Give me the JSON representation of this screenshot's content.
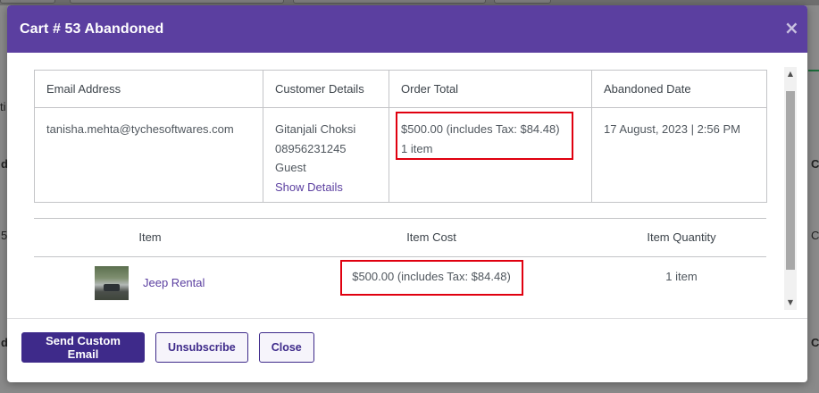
{
  "background": {
    "edge_letters": [
      "d",
      "C",
      "5",
      "C",
      "d",
      "C",
      "ti"
    ]
  },
  "modal": {
    "title": "Cart # 53  Abandoned",
    "close_label": "×"
  },
  "details_table": {
    "headers": [
      "Email Address",
      "Customer Details",
      "Order Total",
      "Abandoned Date"
    ],
    "email": "tanisha.mehta@tychesoftwares.com",
    "customer_name": "Gitanjali Choksi",
    "customer_phone": "08956231245",
    "customer_type": "Guest",
    "show_details_link": "Show Details",
    "order_total": "$500.00 (includes Tax: $84.48)",
    "order_items": "1 item",
    "abandoned_date": "17 August, 2023 | 2:56 PM"
  },
  "items_table": {
    "headers": [
      "Item",
      "Item Cost",
      "Item Quantity"
    ],
    "rows": [
      {
        "name": "Jeep Rental",
        "cost": "$500.00 (includes Tax: $84.48)",
        "quantity": "1 item"
      }
    ]
  },
  "footer": {
    "send_custom_email": "Send Custom Email",
    "unsubscribe": "Unsubscribe",
    "close": "Close"
  },
  "colors": {
    "header_bg": "#5b3fa0",
    "primary_button": "#3e2a8a",
    "highlight_box": "#e0000f"
  }
}
